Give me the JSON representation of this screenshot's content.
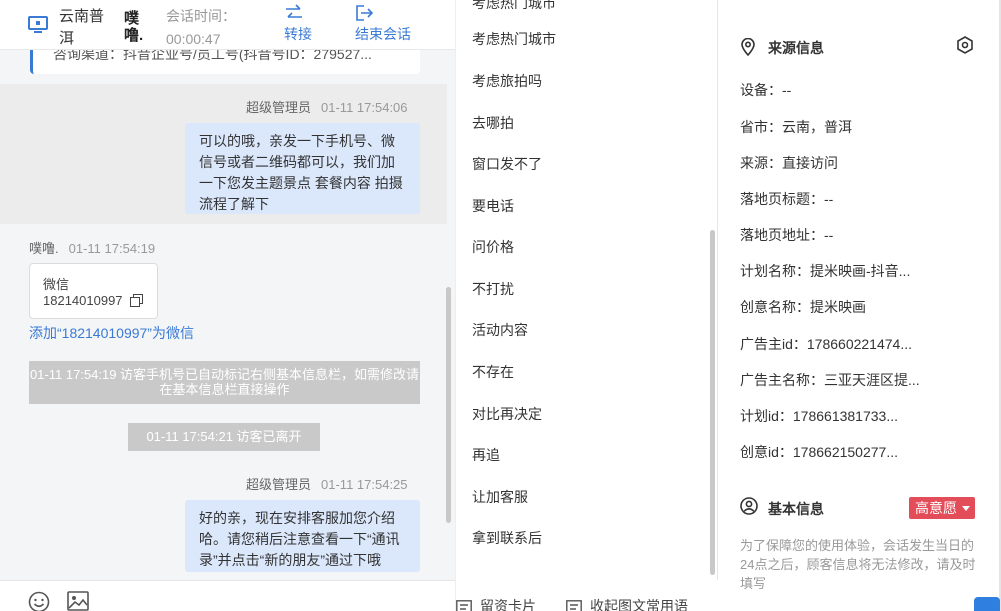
{
  "header": {
    "location": "云南普洱",
    "visitor_name": "噗噜.",
    "time_label": "会话时间：",
    "time_value": "00:00:47",
    "transfer_label": "转接",
    "end_label": "结束会话",
    "accent": "#3a7ad5"
  },
  "chat": {
    "prev_card_text": "咨询渠道：抖音企业号/员工号(抖音号ID：279527...",
    "messages": [
      {
        "sender": "超级管理员",
        "time": "01-11 17:54:06",
        "text": "可以的哦，亲发一下手机号、微信号或者二维码都可以，我们加一下您发主题景点 套餐内容 拍摄流程了解下"
      },
      {
        "sender": "噗噜.",
        "time": "01-11 17:54:19",
        "card_title": "微信",
        "card_value": "18214010997"
      },
      {
        "sender": "超级管理员",
        "time": "01-11 17:54:25",
        "text": "好的亲，现在安排客服加您介绍哈。请您稍后注意查看一下“通讯录”并点击“新的朋友”通过下哦"
      }
    ],
    "add_wechat_link": "添加“18214010997”为微信",
    "system_note_1": "01-11 17:54:19 访客手机号已自动标记右侧基本信息栏，如需修改请在基本信息栏直接操作",
    "system_note_2": "01-11 17:54:21 访客已离开",
    "toolbar_icons": [
      "smile-icon",
      "image-icon"
    ]
  },
  "quick_replies": {
    "items": [
      "考虑热门城市",
      "考虑旅拍吗",
      "去哪拍",
      "窗口发不了",
      "要电话",
      "问价格",
      "不打扰",
      "活动内容",
      "不存在",
      "对比再决定",
      "再追",
      "让加客服",
      "拿到联系后"
    ],
    "footer_card": "留资卡片",
    "footer_collapse": "收起图文常用语"
  },
  "info": {
    "source_title": "来源信息",
    "source_fields": [
      "设备：--",
      "省市：云南，普洱",
      "来源：直接访问",
      "落地页标题：--",
      "落地页地址：--",
      "计划名称：提米映画-抖音...",
      "创意名称：提米映画",
      "广告主id：178660221474...",
      "广告主名称：三亚天涯区提...",
      "计划id：178661381733...",
      "创意id：178662150277..."
    ],
    "basic_title": "基本信息",
    "intent_badge": "高意愿",
    "intent_color": "#e34d59",
    "notice": "为了保障您的使用体验，会话发生当日的24点之后，顾客信息将无法修改，请及时填写"
  }
}
